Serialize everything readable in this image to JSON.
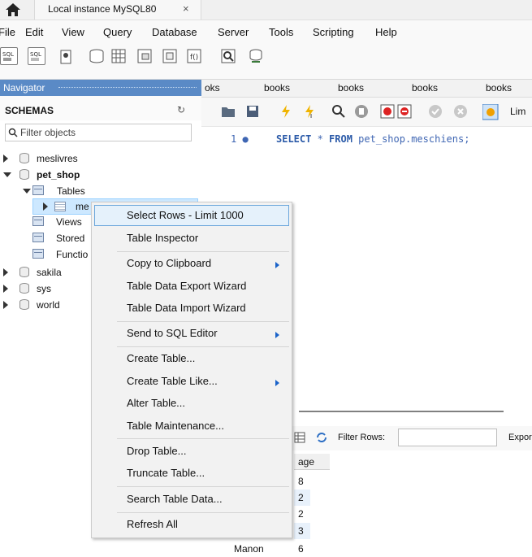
{
  "window": {
    "tab_title": "Local instance MySQL80",
    "tab_close": "×"
  },
  "menubar": [
    "File",
    "Edit",
    "View",
    "Query",
    "Database",
    "Server",
    "Tools",
    "Scripting",
    "Help"
  ],
  "navigator": {
    "header": "Navigator",
    "schemas_label": "SCHEMAS",
    "filter_placeholder": "Filter objects",
    "tree": {
      "meslivres": "meslivres",
      "pet_shop": "pet_shop",
      "tables": "Tables",
      "table_truncated": "me",
      "views": "Views",
      "stored": "Stored",
      "functions": "Functio",
      "sakila": "sakila",
      "sys": "sys",
      "world": "world"
    }
  },
  "editor": {
    "tabs": [
      "oks",
      "books",
      "books",
      "books",
      "books"
    ],
    "limit_label": "Lim",
    "line_number": "1",
    "sql_keyword1": "SELECT",
    "sql_rest1": " * ",
    "sql_keyword2": "FROM",
    "sql_rest2": " pet_shop.meschiens;"
  },
  "result": {
    "filter_rows_label": "Filter Rows:",
    "export_label": "Expor",
    "column_header": "age",
    "ages": [
      "8",
      "2",
      "2",
      "3",
      "6"
    ],
    "name_partial": "Manon"
  },
  "context_menu": {
    "select_rows": "Select Rows - Limit 1000",
    "table_inspector": "Table Inspector",
    "copy_clipboard": "Copy to Clipboard",
    "export_wizard": "Table Data Export Wizard",
    "import_wizard": "Table Data Import Wizard",
    "send_sql": "Send to SQL Editor",
    "create_table": "Create Table...",
    "create_table_like": "Create Table Like...",
    "alter_table": "Alter Table...",
    "maintenance": "Table Maintenance...",
    "drop_table": "Drop Table...",
    "truncate_table": "Truncate Table...",
    "search_data": "Search Table Data...",
    "refresh_all": "Refresh All"
  },
  "colors": {
    "navigator_header": "#5a8ac6",
    "selection": "#cde8ff",
    "menu_highlight": "#e5f1fb",
    "sql_text": "#3f66b3"
  }
}
